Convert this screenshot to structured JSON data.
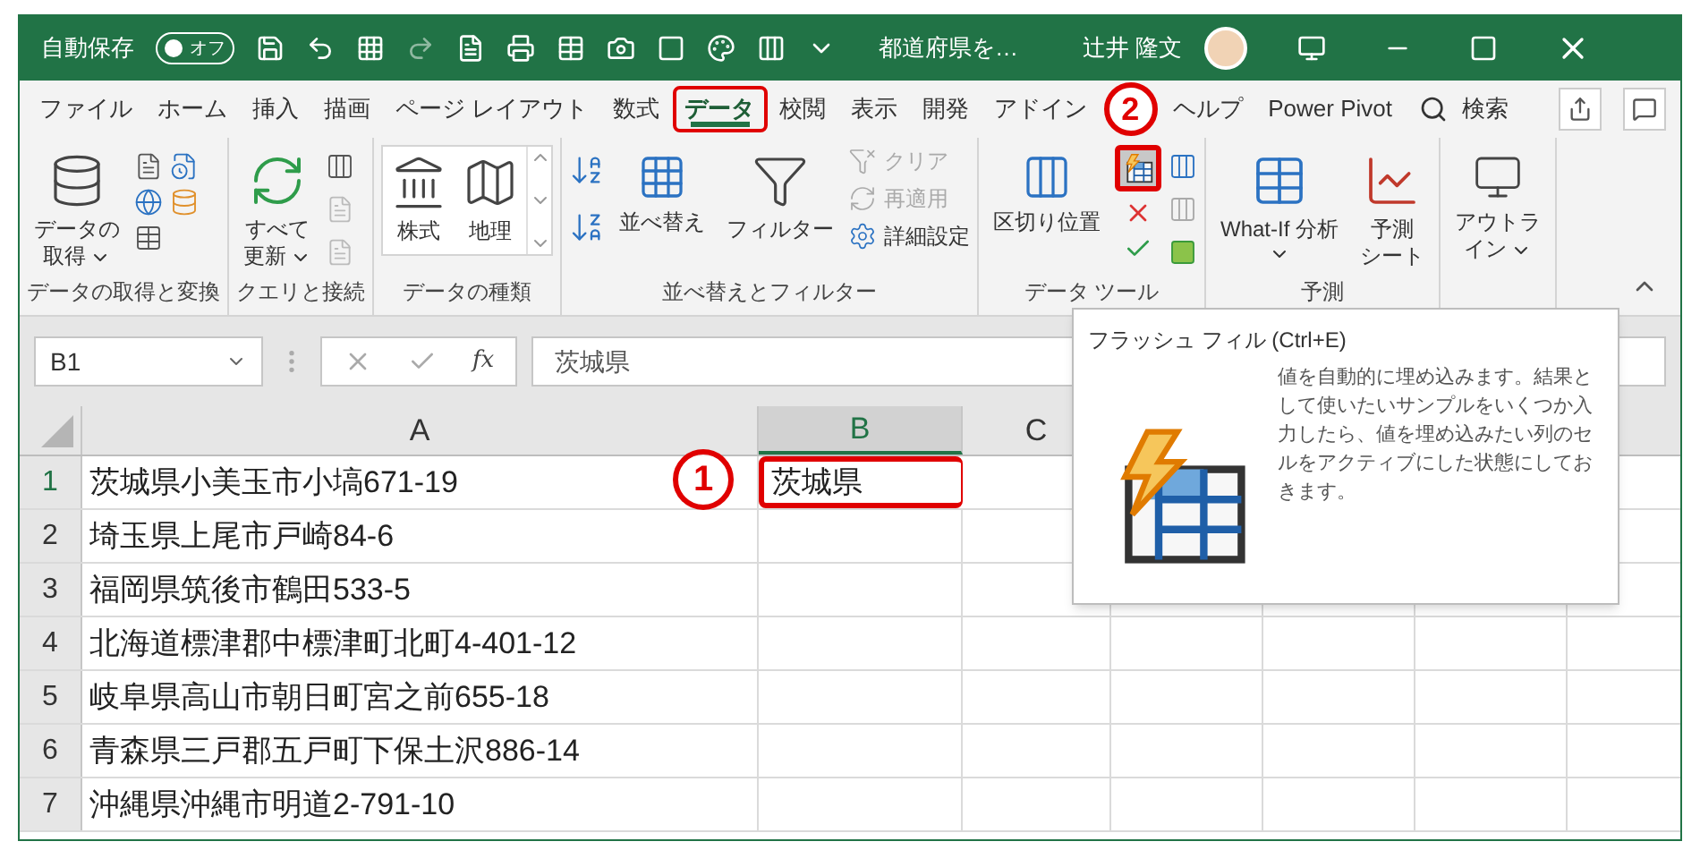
{
  "title_bar": {
    "autosave_label": "自動保存",
    "autosave_toggle": {
      "label": "オフ",
      "on": false
    },
    "filename": "都道府県を…",
    "user": "辻井 隆文"
  },
  "tabs": [
    {
      "label": "ファイル",
      "selected": false,
      "highlighted": false
    },
    {
      "label": "ホーム",
      "selected": false,
      "highlighted": false
    },
    {
      "label": "挿入",
      "selected": false,
      "highlighted": false
    },
    {
      "label": "描画",
      "selected": false,
      "highlighted": false
    },
    {
      "label": "ページ レイアウト",
      "selected": false,
      "highlighted": false
    },
    {
      "label": "数式",
      "selected": false,
      "highlighted": false
    },
    {
      "label": "データ",
      "selected": true,
      "highlighted": true
    },
    {
      "label": "校閲",
      "selected": false,
      "highlighted": false
    },
    {
      "label": "表示",
      "selected": false,
      "highlighted": false
    },
    {
      "label": "開発",
      "selected": false,
      "highlighted": false
    },
    {
      "label": "アドイン",
      "selected": false,
      "highlighted": false
    },
    {
      "label": "ヘルプ",
      "selected": false,
      "highlighted": false
    },
    {
      "label": "Power Pivot",
      "selected": false,
      "highlighted": false
    }
  ],
  "search": {
    "label": "検索"
  },
  "ribbon": {
    "groups": [
      {
        "label": "データの取得と変換",
        "big": [
          {
            "lines": [
              "データの",
              "取得"
            ],
            "dropdown": true
          }
        ]
      },
      {
        "label": "クエリと接続",
        "big": [
          {
            "lines": [
              "すべて",
              "更新"
            ],
            "dropdown": true
          }
        ]
      },
      {
        "label": "データの種類",
        "big": [
          {
            "lines": [
              "株式"
            ],
            "dropdown": false
          },
          {
            "lines": [
              "地理"
            ],
            "dropdown": false
          }
        ]
      },
      {
        "label": "並べ替えとフィルター",
        "big": [
          {
            "lines": [
              "並べ替え"
            ],
            "dropdown": false
          },
          {
            "lines": [
              "フィルター"
            ],
            "dropdown": false
          }
        ],
        "small": [
          {
            "label": "クリア",
            "disabled": true
          },
          {
            "label": "再適用",
            "disabled": true
          },
          {
            "label": "詳細設定",
            "disabled": false
          }
        ]
      },
      {
        "label": "データ ツール",
        "big": [
          {
            "lines": [
              "区切り位置"
            ],
            "dropdown": false
          }
        ],
        "flash_fill": {
          "highlighted": true
        }
      },
      {
        "label": "予測",
        "big": [
          {
            "lines": [
              "What-If 分析"
            ],
            "dropdown": true
          },
          {
            "lines": [
              "予測",
              "シート"
            ],
            "dropdown": false
          }
        ]
      },
      {
        "big": [
          {
            "lines": [
              "アウトラ",
              "イン"
            ],
            "dropdown": true
          }
        ]
      }
    ]
  },
  "formula_bar": {
    "name_box": "B1",
    "fx": "fx",
    "value": "茨城県"
  },
  "sheet": {
    "columns": [
      {
        "label": "A",
        "selected": false
      },
      {
        "label": "B",
        "selected": true
      },
      {
        "label": "C",
        "selected": false
      }
    ],
    "rows": [
      {
        "number": "1",
        "selected": true,
        "cells": [
          "茨城県小美玉市小塙671-19",
          "茨城県"
        ],
        "highlighted": true
      },
      {
        "number": "2",
        "selected": false,
        "cells": [
          "埼玉県上尾市戸崎84-6",
          ""
        ],
        "highlighted": false
      },
      {
        "number": "3",
        "selected": false,
        "cells": [
          "福岡県筑後市鶴田533-5",
          ""
        ],
        "highlighted": false
      },
      {
        "number": "4",
        "selected": false,
        "cells": [
          "北海道標津郡中標津町北町4-401-12",
          ""
        ],
        "highlighted": false
      },
      {
        "number": "5",
        "selected": false,
        "cells": [
          "岐阜県高山市朝日町宮之前655-18",
          ""
        ],
        "highlighted": false
      },
      {
        "number": "6",
        "selected": false,
        "cells": [
          "青森県三戸郡五戸町下保土沢886-14",
          ""
        ],
        "highlighted": false
      },
      {
        "number": "7",
        "selected": false,
        "cells": [
          "沖縄県沖縄市明道2-791-10",
          ""
        ],
        "highlighted": false
      }
    ]
  },
  "tooltip": {
    "title": "フラッシュ フィル (Ctrl+E)",
    "description": "値を自動的に埋め込みます。結果として使いたいサンプルをいくつか入力したら、値を埋め込みたい列のセルをアクティブにした状態にしておきます。"
  },
  "annotations": [
    {
      "label": "1"
    },
    {
      "label": "2"
    }
  ]
}
